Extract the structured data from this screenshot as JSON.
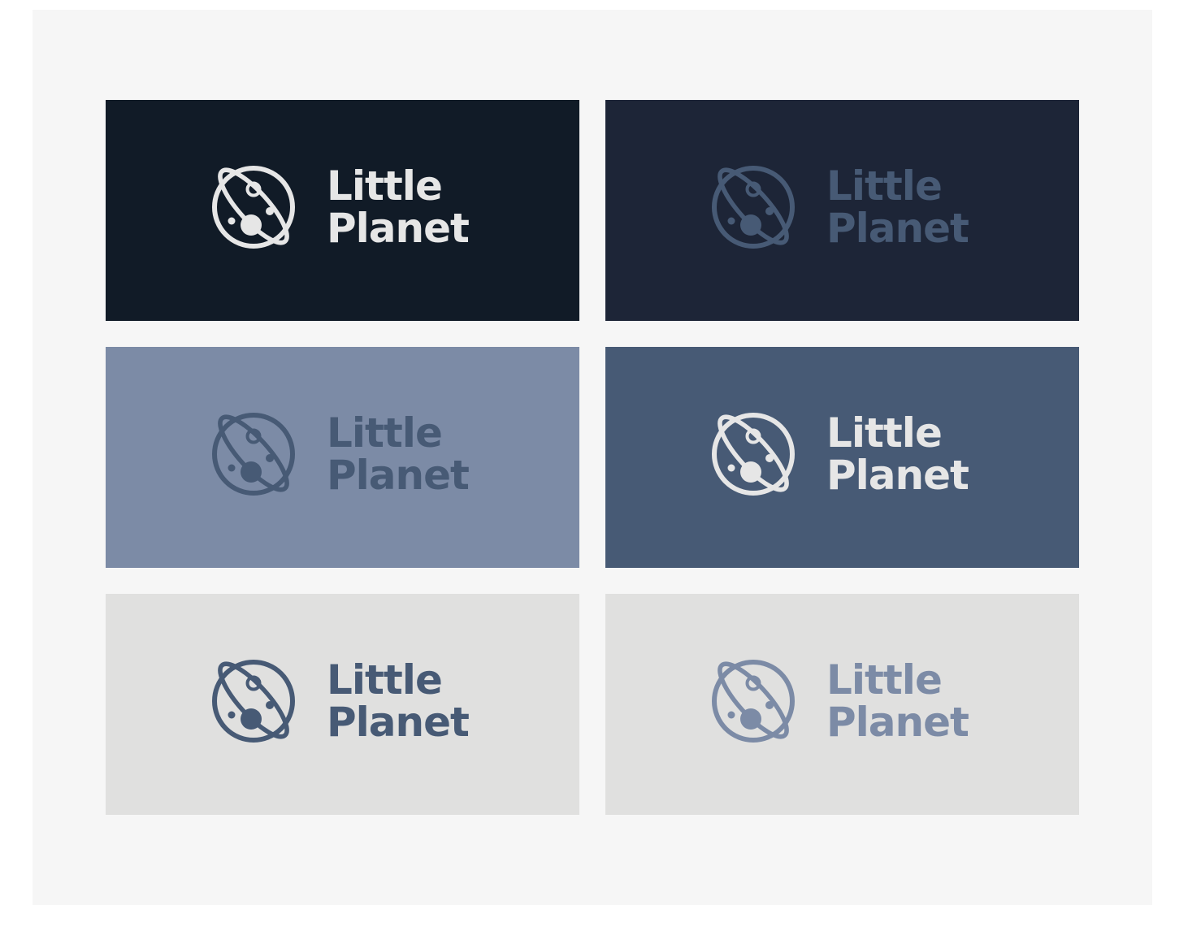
{
  "brand": {
    "line1": "Little",
    "line2": "Planet"
  },
  "tiles": [
    {
      "background": "#111b27",
      "foreground": "#e6e6e6"
    },
    {
      "background": "#1d2537",
      "foreground": "#475a75"
    },
    {
      "background": "#7c8ba6",
      "foreground": "#475a75"
    },
    {
      "background": "#475a75",
      "foreground": "#e6e6e6"
    },
    {
      "background": "#e0e0df",
      "foreground": "#475a75"
    },
    {
      "background": "#e0e0df",
      "foreground": "#7c8ba6"
    }
  ]
}
